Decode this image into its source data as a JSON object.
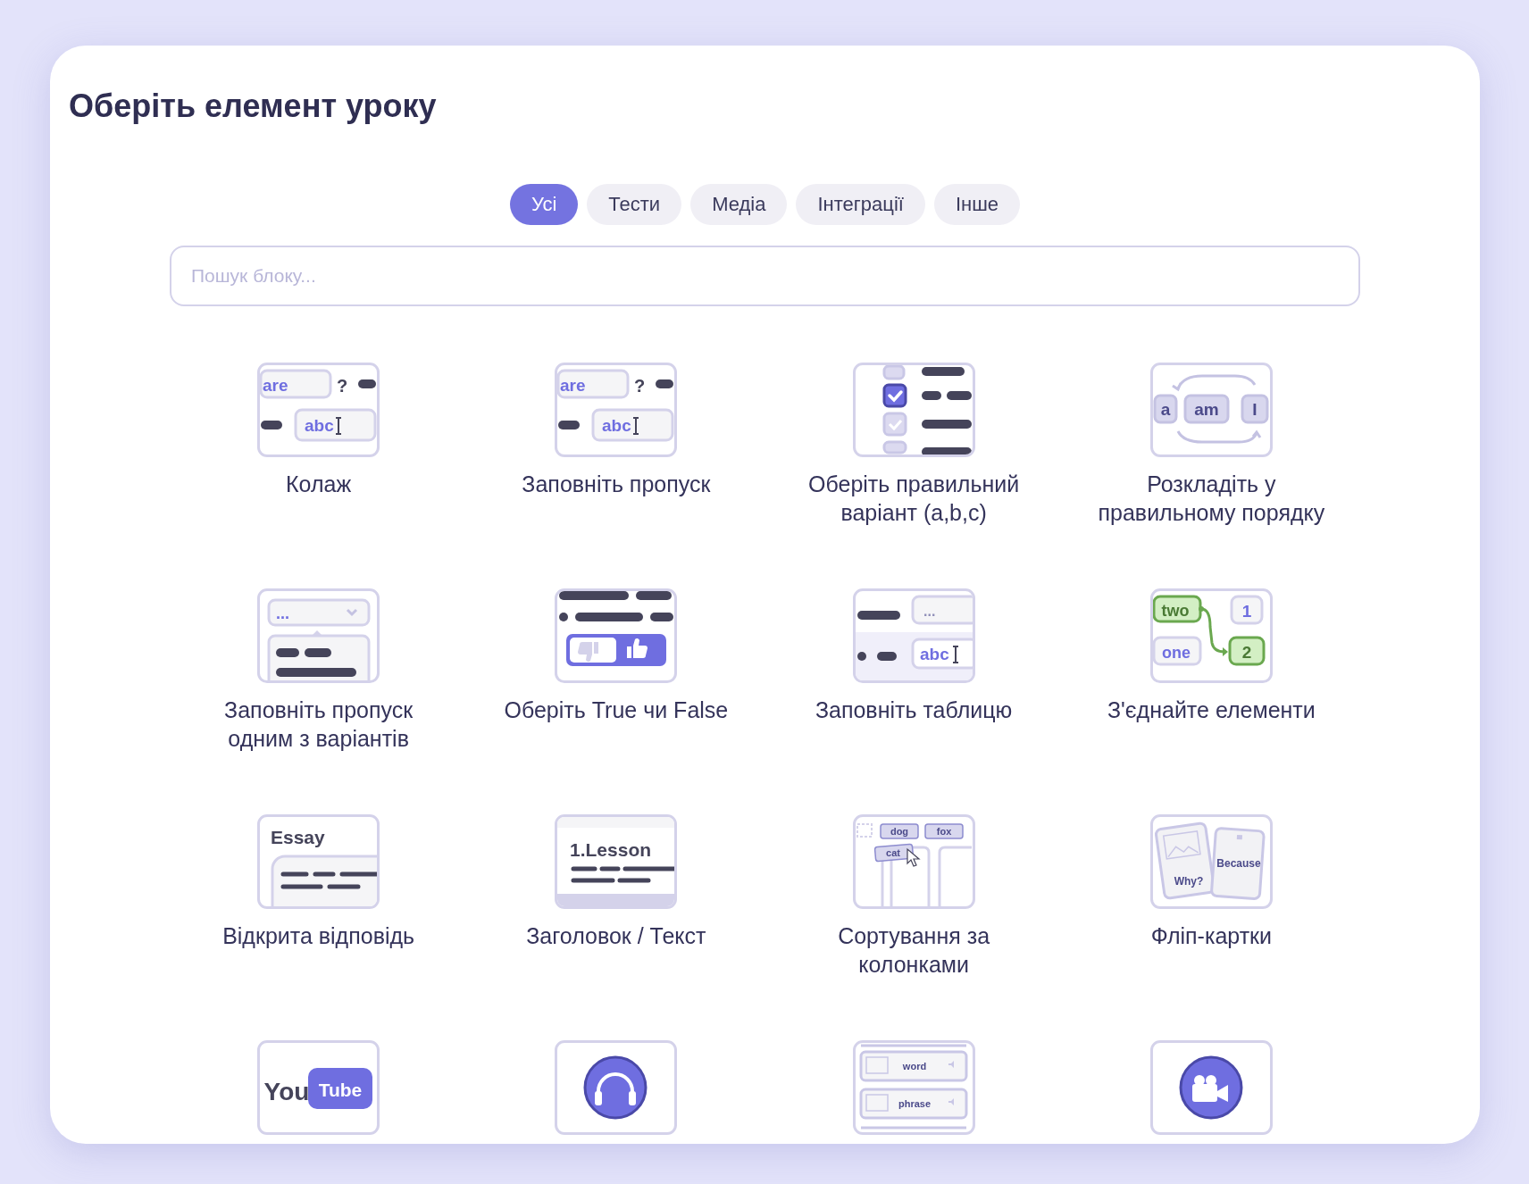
{
  "title": "Оберіть елемент уроку",
  "tabs": [
    {
      "label": "Усі",
      "selected": true
    },
    {
      "label": "Тести",
      "selected": false
    },
    {
      "label": "Медіа",
      "selected": false
    },
    {
      "label": "Інтеграції",
      "selected": false
    },
    {
      "label": "Інше",
      "selected": false
    }
  ],
  "search": {
    "placeholder": "Пошук блоку..."
  },
  "blocks": [
    {
      "kind": "fill_gap",
      "label": "Колаж",
      "preview_texts": [
        "are",
        "?",
        "abc"
      ]
    },
    {
      "kind": "fill_gap",
      "label": "Заповніть пропуск",
      "preview_texts": [
        "are",
        "?",
        "abc"
      ]
    },
    {
      "kind": "multiple_choice",
      "label": "Оберіть правильний варіант (a,b,c)"
    },
    {
      "kind": "order",
      "label": "Розкладіть у правильному порядку",
      "preview_texts": [
        "a",
        "am",
        "I"
      ]
    },
    {
      "kind": "dropdown_gap",
      "label": "Заповніть пропуск одним з варіантів",
      "preview_texts": [
        "..."
      ]
    },
    {
      "kind": "true_false",
      "label": "Оберіть True чи False"
    },
    {
      "kind": "table",
      "label": "Заповніть таблицю",
      "preview_texts": [
        "...",
        "abc"
      ]
    },
    {
      "kind": "match",
      "label": "З'єднайте елементи",
      "preview_texts": [
        "two",
        "one",
        "1",
        "2"
      ]
    },
    {
      "kind": "essay",
      "label": "Відкрита відповідь",
      "preview_texts": [
        "Essay"
      ]
    },
    {
      "kind": "heading",
      "label": "Заголовок / Текст",
      "preview_texts": [
        "1.Lesson"
      ]
    },
    {
      "kind": "sort_columns",
      "label": "Сортування за колонками",
      "preview_texts": [
        "dog",
        "fox",
        "cat"
      ]
    },
    {
      "kind": "flip_cards",
      "label": "Фліп-картки",
      "preview_texts": [
        "Why?",
        "Because"
      ]
    },
    {
      "kind": "youtube",
      "preview_texts": [
        "You",
        "Tube"
      ]
    },
    {
      "kind": "audio"
    },
    {
      "kind": "vocab",
      "preview_texts": [
        "word",
        "phrase"
      ]
    },
    {
      "kind": "video"
    }
  ]
}
